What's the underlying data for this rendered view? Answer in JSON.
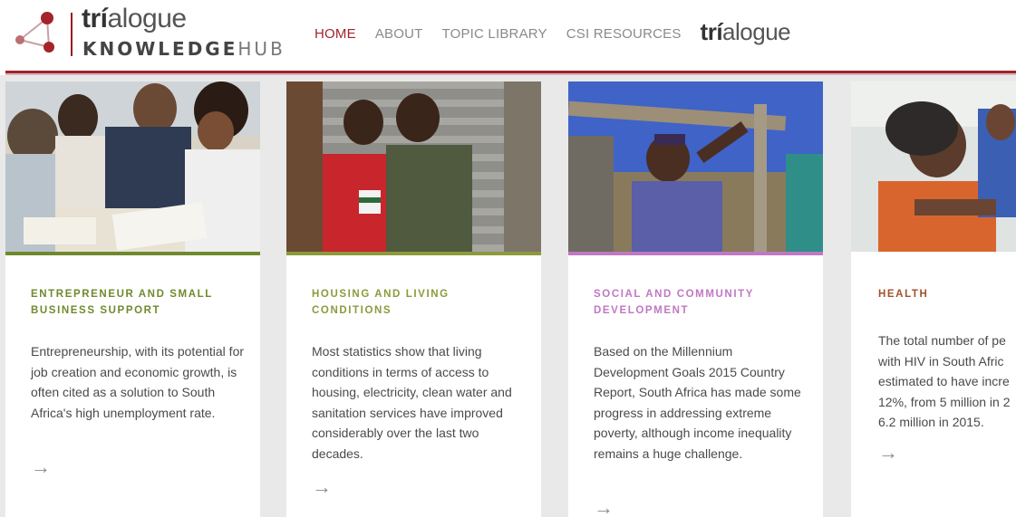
{
  "brand": {
    "logo_word_bold": "trí",
    "logo_word_rest": "alogue",
    "logo_sub_bold": "KNOWLEDGE",
    "logo_sub_light": "HUB",
    "accent": "#a3242a"
  },
  "nav": {
    "items": [
      {
        "label": "HOME",
        "active": true
      },
      {
        "label": "ABOUT",
        "active": false
      },
      {
        "label": "TOPIC LIBRARY",
        "active": false
      },
      {
        "label": "CSI RESOURCES",
        "active": false
      }
    ],
    "brand_bold": "trí",
    "brand_rest": "alogue"
  },
  "cards": [
    {
      "title": "ENTREPRENEUR AND SMALL BUSINESS SUPPORT",
      "text": "Entrepreneurship, with its potential for job creation and economic growth, is often cited as a solution to South Africa's high unemployment rate.",
      "color": "#6f8a2e",
      "arrow": "→",
      "image": "people-studying-photo"
    },
    {
      "title": "HOUSING AND LIVING CONDITIONS",
      "text": "Most statistics show that living conditions in terms of access to housing, electricity, clean water and sanitation services have improved considerably over the last two decades.",
      "color": "#8c9a3c",
      "arrow": "→",
      "image": "children-corrugated-wall-photo"
    },
    {
      "title": "SOCIAL AND COMMUNITY DEVELOPMENT",
      "text": "Based on the Millennium Development Goals 2015 Country Report, South Africa has made some progress in addressing extreme poverty, although income inequality remains a huge challenge.",
      "color": "#c178c3",
      "arrow": "→",
      "image": "woman-pointing-photo"
    },
    {
      "title": "HEALTH",
      "text": "The total number of pe with HIV in South Afric estimated to have incre 12%, from 5 million in 2 6.2 million in 2015.",
      "color": "#a0522d",
      "arrow": "→",
      "image": "elderly-woman-nurse-photo"
    }
  ]
}
